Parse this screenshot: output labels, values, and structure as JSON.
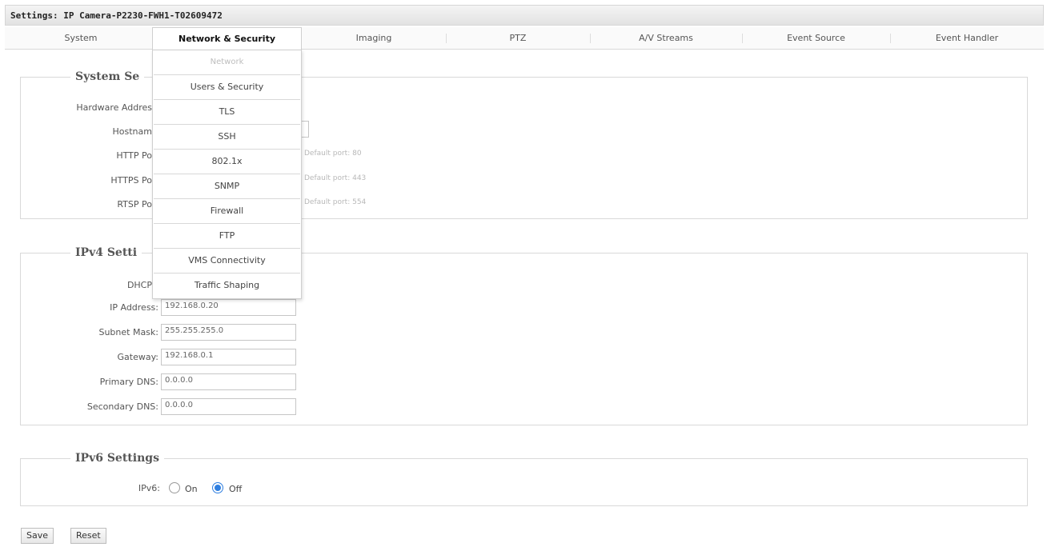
{
  "window": {
    "title": "Settings: IP Camera-P2230-FWH1-T02609472"
  },
  "tabs": [
    {
      "label": "System"
    },
    {
      "label": "Network & Security"
    },
    {
      "label": "Imaging"
    },
    {
      "label": "PTZ"
    },
    {
      "label": "A/V Streams"
    },
    {
      "label": "Event Source"
    },
    {
      "label": "Event Handler"
    }
  ],
  "dropdown": {
    "items": [
      {
        "label": "Network",
        "disabled": true
      },
      {
        "label": "Users & Security"
      },
      {
        "label": "TLS"
      },
      {
        "label": "SSH"
      },
      {
        "label": "802.1x"
      },
      {
        "label": "SNMP"
      },
      {
        "label": "Firewall"
      },
      {
        "label": "FTP"
      },
      {
        "label": "VMS Connectivity"
      },
      {
        "label": "Traffic Shaping"
      }
    ]
  },
  "system_settings": {
    "legend": "System Se",
    "hardware_address_label": "Hardware Addres",
    "hostname_label": "Hostnam",
    "http_port_label": "HTTP Po",
    "http_port_hint": "Default port: 80",
    "https_port_label": "HTTPS Po",
    "https_port_hint": "Default port: 443",
    "rtsp_port_label": "RTSP Po",
    "rtsp_port_hint": "Default port: 554"
  },
  "ipv4_settings": {
    "legend": "IPv4 Setti",
    "dhcp_label": "DHCP",
    "ip_address_label": "IP Address:",
    "ip_address_value": "192.168.0.20",
    "subnet_mask_label": "Subnet Mask:",
    "subnet_mask_value": "255.255.255.0",
    "gateway_label": "Gateway:",
    "gateway_value": "192.168.0.1",
    "primary_dns_label": "Primary DNS:",
    "primary_dns_value": "0.0.0.0",
    "secondary_dns_label": "Secondary DNS:",
    "secondary_dns_value": "0.0.0.0"
  },
  "ipv6_settings": {
    "legend": "IPv6 Settings",
    "ipv6_label": "IPv6:",
    "on_label": "On",
    "off_label": "Off",
    "selected": "Off"
  },
  "actions": {
    "save_label": "Save",
    "reset_label": "Reset"
  },
  "colors": {
    "accent": "#2f7fe0",
    "border": "#d9d9d9"
  }
}
